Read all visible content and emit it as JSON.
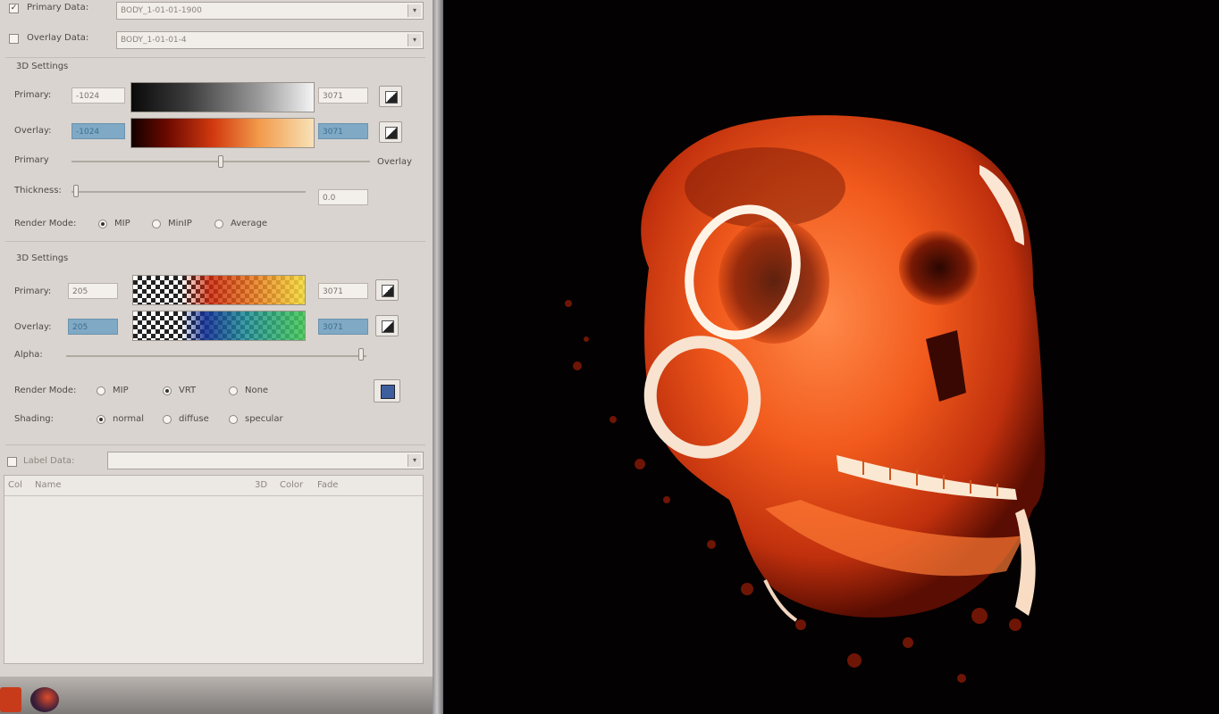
{
  "panel": {
    "primary_data_label": "Primary Data:",
    "primary_data_value": "BODY_1-01-01-1900",
    "overlay_data_label": "Overlay Data:",
    "overlay_data_value": "BODY_1-01-01-4",
    "section1_title": "3D Settings",
    "primary_label": "Primary:",
    "primary_min": "-1024",
    "primary_max": "3071",
    "overlay_label": "Overlay:",
    "overlay_min": "-1024",
    "overlay_max": "3071",
    "blend_left": "Primary",
    "blend_right": "Overlay",
    "thickness_label": "Thickness:",
    "thickness_value": "0.0",
    "render_mode_label": "Render Mode:",
    "render_modes_1": [
      "MIP",
      "MinIP",
      "Average"
    ],
    "section2_title": "3D Settings",
    "primary2_min": "205",
    "primary2_max": "3071",
    "overlay2_min": "205",
    "overlay2_max": "3071",
    "alpha_label": "Alpha:",
    "render_mode2_label": "Render Mode:",
    "render_modes_2": [
      "MIP",
      "VRT",
      "None"
    ],
    "shading_label": "Shading:",
    "shading_modes": [
      "normal",
      "diffuse",
      "specular"
    ],
    "label_data_label": "Label Data:",
    "table_headers": [
      "Col",
      "Name",
      "3D",
      "Color",
      "Fade"
    ]
  },
  "colors": {
    "panel_bg": "#d9d4cf",
    "viewport_bg": "#030101",
    "selection_blue": "#7fa9c5",
    "skull_orange": "#f15a1c"
  },
  "viewport": {
    "content": "volume-rendered-skull"
  }
}
